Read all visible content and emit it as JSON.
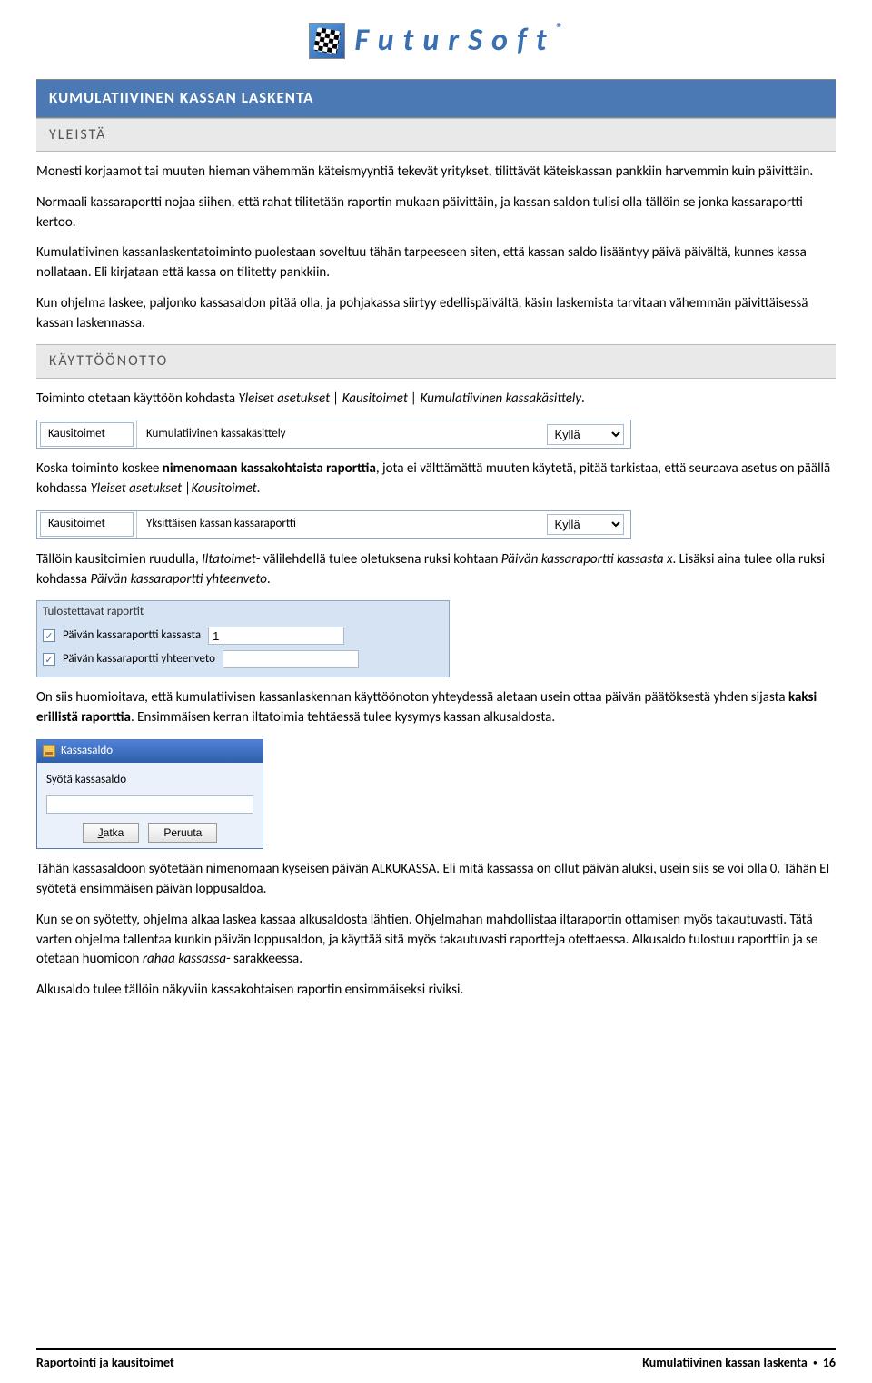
{
  "logo": {
    "brand": "FuturSoft",
    "reg": "®"
  },
  "titleBar": "KUMULATIIVINEN KASSAN LASKENTA",
  "sec1": {
    "head": "YLEISTÄ",
    "p1": "Monesti korjaamot tai muuten hieman vähemmän käteismyyntiä tekevät yritykset, tilittävät käteiskassan pankkiin harvemmin kuin päivittäin.",
    "p2": "Normaali kassaraportti nojaa siihen, että rahat tilitetään raportin mukaan päivittäin, ja kassan saldon tulisi olla tällöin se jonka kassaraportti kertoo.",
    "p3": "Kumulatiivinen kassanlaskentatoiminto puolestaan soveltuu tähän tarpeeseen siten, että kassan saldo lisääntyy päivä päivältä, kunnes kassa nollataan. Eli kirjataan että kassa on tilitetty pankkiin.",
    "p4": "Kun ohjelma laskee, paljonko kassasaldon pitää olla, ja pohjakassa siirtyy edellispäivältä, käsin laskemista tarvitaan vähemmän päivittäisessä kassan laskennassa."
  },
  "sec2": {
    "head": "KÄYTTÖÖNOTTO",
    "p1a": "Toiminto otetaan käyttöön kohdasta ",
    "p1b": "Yleiset asetukset | Kausitoimet | Kumulatiivinen kassakäsittely",
    "p1c": ".",
    "set1": {
      "cat": "Kausitoimet",
      "lbl": "Kumulatiivinen kassakäsittely",
      "val": "Kyllä"
    },
    "p2a": "Koska toiminto koskee ",
    "p2b": "nimenomaan kassakohtaista raporttia",
    "p2c": ", jota ei välttämättä muuten käytetä, pitää tarkistaa, että seuraava asetus on päällä kohdassa ",
    "p2d": "Yleiset asetukset |Kausitoimet",
    "p2e": ".",
    "set2": {
      "cat": "Kausitoimet",
      "lbl": "Yksittäisen kassan kassaraportti",
      "val": "Kyllä"
    },
    "p3a": "Tällöin kausitoimien ruudulla, ",
    "p3b": "Iltatoimet",
    "p3c": "- välilehdellä tulee oletuksena ruksi kohtaan ",
    "p3d": "Päivän kassaraportti kassasta x",
    "p3e": ". Lisäksi aina tulee olla ruksi kohdassa ",
    "p3f": "Päivän kassaraportti yhteenveto",
    "p3g": ".",
    "rpt": {
      "header": "Tulostettavat raportit",
      "row1": "Päivän kassaraportti kassasta",
      "row1val": "1",
      "row2": "Päivän kassaraportti yhteenveto",
      "row2val": ""
    },
    "p4a": "On siis huomioitava, että kumulatiivisen kassanlaskennan käyttöönoton yhteydessä aletaan usein ottaa päivän päätöksestä yhden sijasta ",
    "p4b": "kaksi erillistä raporttia",
    "p4c": ". Ensimmäisen kerran iltatoimia tehtäessä tulee kysymys kassan alkusaldosta.",
    "dlg": {
      "title": "Kassasaldo",
      "prompt": "Syötä kassasaldo",
      "value": "",
      "ok": "Jatka",
      "cancel": "Peruuta"
    },
    "p5": "Tähän kassasaldoon syötetään nimenomaan kyseisen päivän ALKUKASSA. Eli mitä kassassa on ollut päivän aluksi, usein siis se voi olla 0. Tähän EI syötetä ensimmäisen päivän loppusaldoa.",
    "p6a": "Kun se on syötetty, ohjelma alkaa laskea kassaa alkusaldosta lähtien. Ohjelmahan mahdollistaa iltaraportin ottamisen myös takautuvasti. Tätä varten ohjelma tallentaa kunkin päivän loppusaldon, ja käyttää sitä myös takautuvasti raportteja otettaessa. Alkusaldo tulostuu raporttiin ja se otetaan huomioon ",
    "p6b": "rahaa kassassa",
    "p6c": "- sarakkeessa.",
    "p7": "Alkusaldo tulee tällöin näkyviin kassakohtaisen raportin ensimmäiseksi riviksi."
  },
  "footer": {
    "left": "Raportointi ja kausitoimet",
    "rightTitle": "Kumulatiivinen kassan laskenta",
    "bullet": "•",
    "page": "16"
  }
}
